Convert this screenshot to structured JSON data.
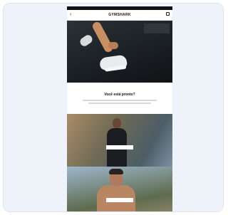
{
  "topbar": {
    "text": ""
  },
  "header": {
    "back_icon": "chevron-left-icon",
    "logo": "GYMSHARK",
    "account": "",
    "bag_icon": "bag-icon"
  },
  "hero": {
    "image": "sneaker-lacing-photo"
  },
  "promo": {
    "title": "Você está pronto?"
  },
  "panels": [
    {
      "title": "",
      "button": ""
    },
    {
      "title": "",
      "button": ""
    }
  ],
  "colors": {
    "dark": "#111111",
    "accent": "#ffffff",
    "card_bg": "#eef2f9"
  }
}
